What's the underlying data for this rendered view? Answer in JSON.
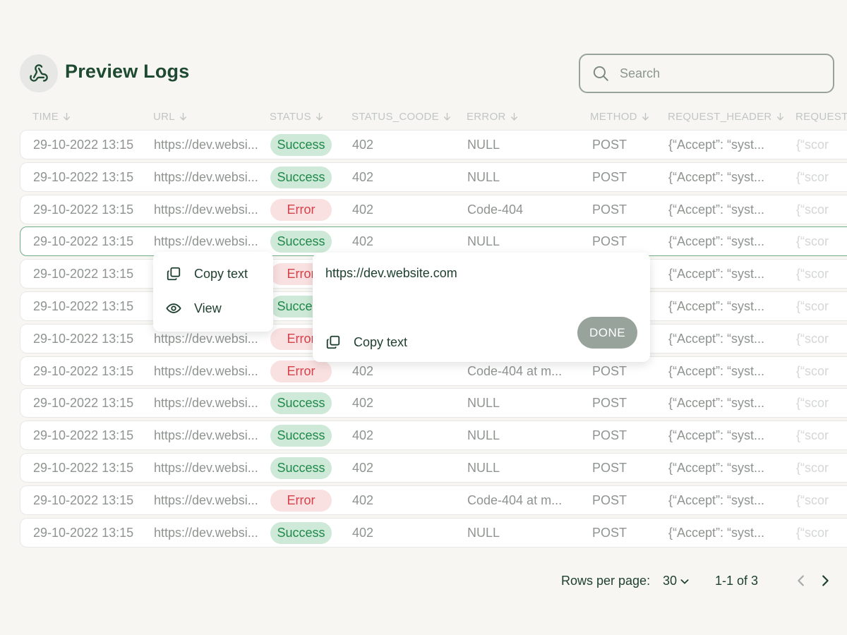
{
  "header": {
    "title": "Preview Logs",
    "logo_icon": "webhook-icon",
    "search_placeholder": "Search"
  },
  "table": {
    "columns": [
      {
        "label": "TIME"
      },
      {
        "label": "URL"
      },
      {
        "label": "STATUS"
      },
      {
        "label": "STATUS_COODE"
      },
      {
        "label": "ERROR"
      },
      {
        "label": "METHOD"
      },
      {
        "label": "REQUEST_HEADER"
      },
      {
        "label": "REQUEST_"
      }
    ],
    "rows": [
      {
        "time": "29-10-2022 13:15",
        "url": "https://dev.websi...",
        "status": "Success",
        "code": "402",
        "error": "NULL",
        "method": "POST",
        "header": "{“Accept”: “syst...",
        "body": "{“scor"
      },
      {
        "time": "29-10-2022 13:15",
        "url": "https://dev.websi...",
        "status": "Success",
        "code": "402",
        "error": "NULL",
        "method": "POST",
        "header": "{“Accept”: “syst...",
        "body": "{“scor"
      },
      {
        "time": "29-10-2022 13:15",
        "url": "https://dev.websi...",
        "status": "Error",
        "code": "402",
        "error": "Code-404",
        "method": "POST",
        "header": "{“Accept”: “syst...",
        "body": "{“scor"
      },
      {
        "time": "29-10-2022 13:15",
        "url": "https://dev.websi...",
        "status": "Success",
        "code": "402",
        "error": "NULL",
        "method": "POST",
        "header": "{“Accept”: “syst...",
        "body": "{“scor"
      },
      {
        "time": "29-10-2022 13:15",
        "url": "",
        "status": "Error",
        "code": "",
        "error": "",
        "method": "",
        "header": "{“Accept”: “syst...",
        "body": "{“scor"
      },
      {
        "time": "29-10-2022 13:15",
        "url": "",
        "status": "Success",
        "code": "",
        "error": "",
        "method": "",
        "header": "{“Accept”: “syst...",
        "body": "{“scor"
      },
      {
        "time": "29-10-2022 13:15",
        "url": "https://dev.websi...",
        "status": "Error",
        "code": "",
        "error": "",
        "method": "",
        "header": "{“Accept”: “syst...",
        "body": "{“scor"
      },
      {
        "time": "29-10-2022 13:15",
        "url": "https://dev.websi...",
        "status": "Error",
        "code": "402",
        "error": "Code-404 at m...",
        "method": "POST",
        "header": "{“Accept”: “syst...",
        "body": "{“scor"
      },
      {
        "time": "29-10-2022 13:15",
        "url": "https://dev.websi...",
        "status": "Success",
        "code": "402",
        "error": "NULL",
        "method": "POST",
        "header": "{“Accept”: “syst...",
        "body": "{“scor"
      },
      {
        "time": "29-10-2022 13:15",
        "url": "https://dev.websi...",
        "status": "Success",
        "code": "402",
        "error": "NULL",
        "method": "POST",
        "header": "{“Accept”: “syst...",
        "body": "{“scor"
      },
      {
        "time": "29-10-2022 13:15",
        "url": "https://dev.websi...",
        "status": "Success",
        "code": "402",
        "error": "NULL",
        "method": "POST",
        "header": "{“Accept”: “syst...",
        "body": "{“scor"
      },
      {
        "time": "29-10-2022 13:15",
        "url": "https://dev.websi...",
        "status": "Error",
        "code": "402",
        "error": "Code-404 at m...",
        "method": "POST",
        "header": "{“Accept”: “syst...",
        "body": "{“scor"
      },
      {
        "time": "29-10-2022 13:15",
        "url": "https://dev.websi...",
        "status": "Success",
        "code": "402",
        "error": "NULL",
        "method": "POST",
        "header": "{“Accept”: “syst...",
        "body": "{“scor"
      }
    ],
    "selected_row": 3
  },
  "context_menu": {
    "items": [
      {
        "label": "Copy text",
        "icon": "copy-icon"
      },
      {
        "label": "View",
        "icon": "eye-icon"
      }
    ]
  },
  "popover": {
    "url": "https://dev.website.com",
    "copy_label": "Copy text",
    "done_label": "DONE"
  },
  "pagination": {
    "rows_per_page_label": "Rows per page:",
    "rows_per_page_value": "30",
    "range_text": "1-1 of 3"
  },
  "colors": {
    "brand": "#1f4a32",
    "success_bg": "#cfe9d8",
    "success_text": "#1e8a4a",
    "error_bg": "#fae1e1",
    "error_text": "#d6404a",
    "selected_border": "#6fae87",
    "done_button": "#97a39b"
  }
}
